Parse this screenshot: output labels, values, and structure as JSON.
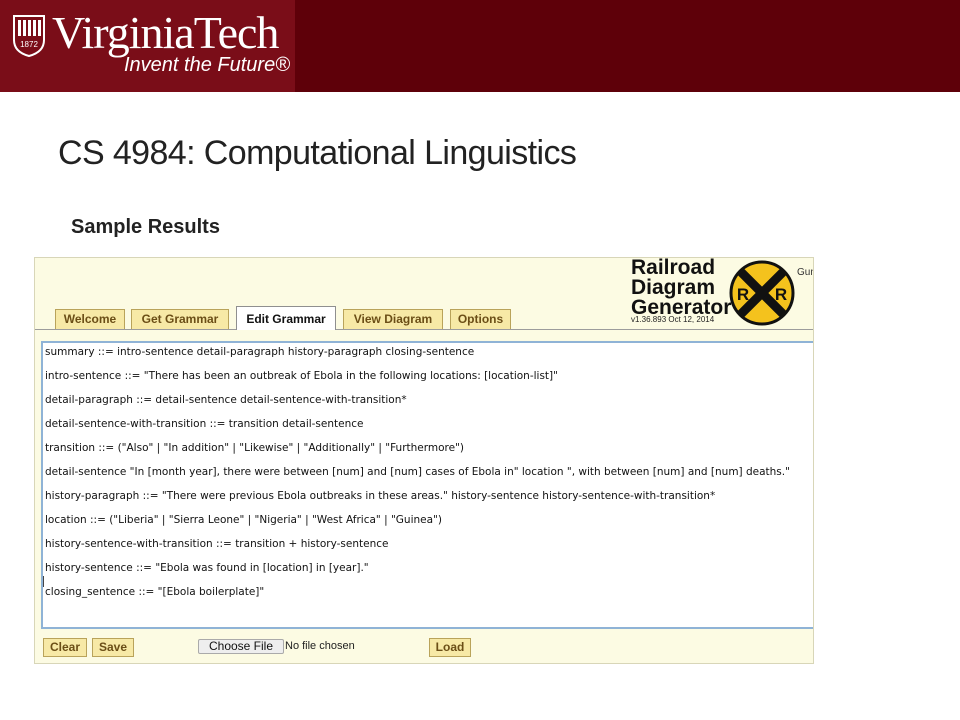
{
  "header": {
    "logo_year": "1872",
    "logo_wordmark": "VirginiaTech",
    "logo_tagline": "Invent the Future®"
  },
  "slide": {
    "title": "CS 4984: Computational Linguistics",
    "section_heading": "Sample Results"
  },
  "app": {
    "title_lines": [
      "Railroad",
      "Diagram",
      "Generator"
    ],
    "version": "v1.36.893 Oct 12, 2014",
    "logo_letters": [
      "R",
      "R"
    ],
    "gun_text": "Gun",
    "tabs": [
      {
        "label": "Welcome",
        "active": false
      },
      {
        "label": "Get Grammar",
        "active": false
      },
      {
        "label": "Edit Grammar",
        "active": true
      },
      {
        "label": "View Diagram",
        "active": false
      },
      {
        "label": "Options",
        "active": false
      }
    ],
    "grammar_lines": [
      "summary ::= intro-sentence detail-paragraph history-paragraph closing-sentence",
      "intro-sentence ::=   \"There has been an outbreak of Ebola in the following locations:  [location-list]\"",
      "detail-paragraph ::=  detail-sentence  detail-sentence-with-transition*",
      "detail-sentence-with-transition ::= transition detail-sentence",
      "transition ::= (\"Also\" | \"In addition\" | \"Likewise\" | \"Additionally\"  | \"Furthermore\")",
      "detail-sentence \"In [month year], there were between [num] and [num] cases of Ebola in\" location \", with between [num] and [num] deaths.\"",
      "history-paragraph ::= \"There were previous Ebola outbreaks in these areas.\"  history-sentence  history-sentence-with-transition*",
      "location ::= (\"Liberia\" | \"Sierra Leone\" | \"Nigeria\" | \"West Africa\" | \"Guinea\")",
      "history-sentence-with-transition ::= transition + history-sentence",
      "history-sentence ::= \"Ebola was found in [location] in [year].\"",
      "closing_sentence ::= \"[Ebola boilerplate]\""
    ],
    "buttons": {
      "clear": "Clear",
      "save": "Save",
      "choose_file": "Choose File",
      "file_status": "No file chosen",
      "load": "Load"
    }
  },
  "colors": {
    "header_band": "#5e0009",
    "logo_box": "#7a0d18",
    "tab_fill": "#f7e9a6",
    "tab_text": "#6b4e16",
    "editor_border": "#8fb3d6",
    "rr_sign_yellow": "#f4c21d"
  }
}
